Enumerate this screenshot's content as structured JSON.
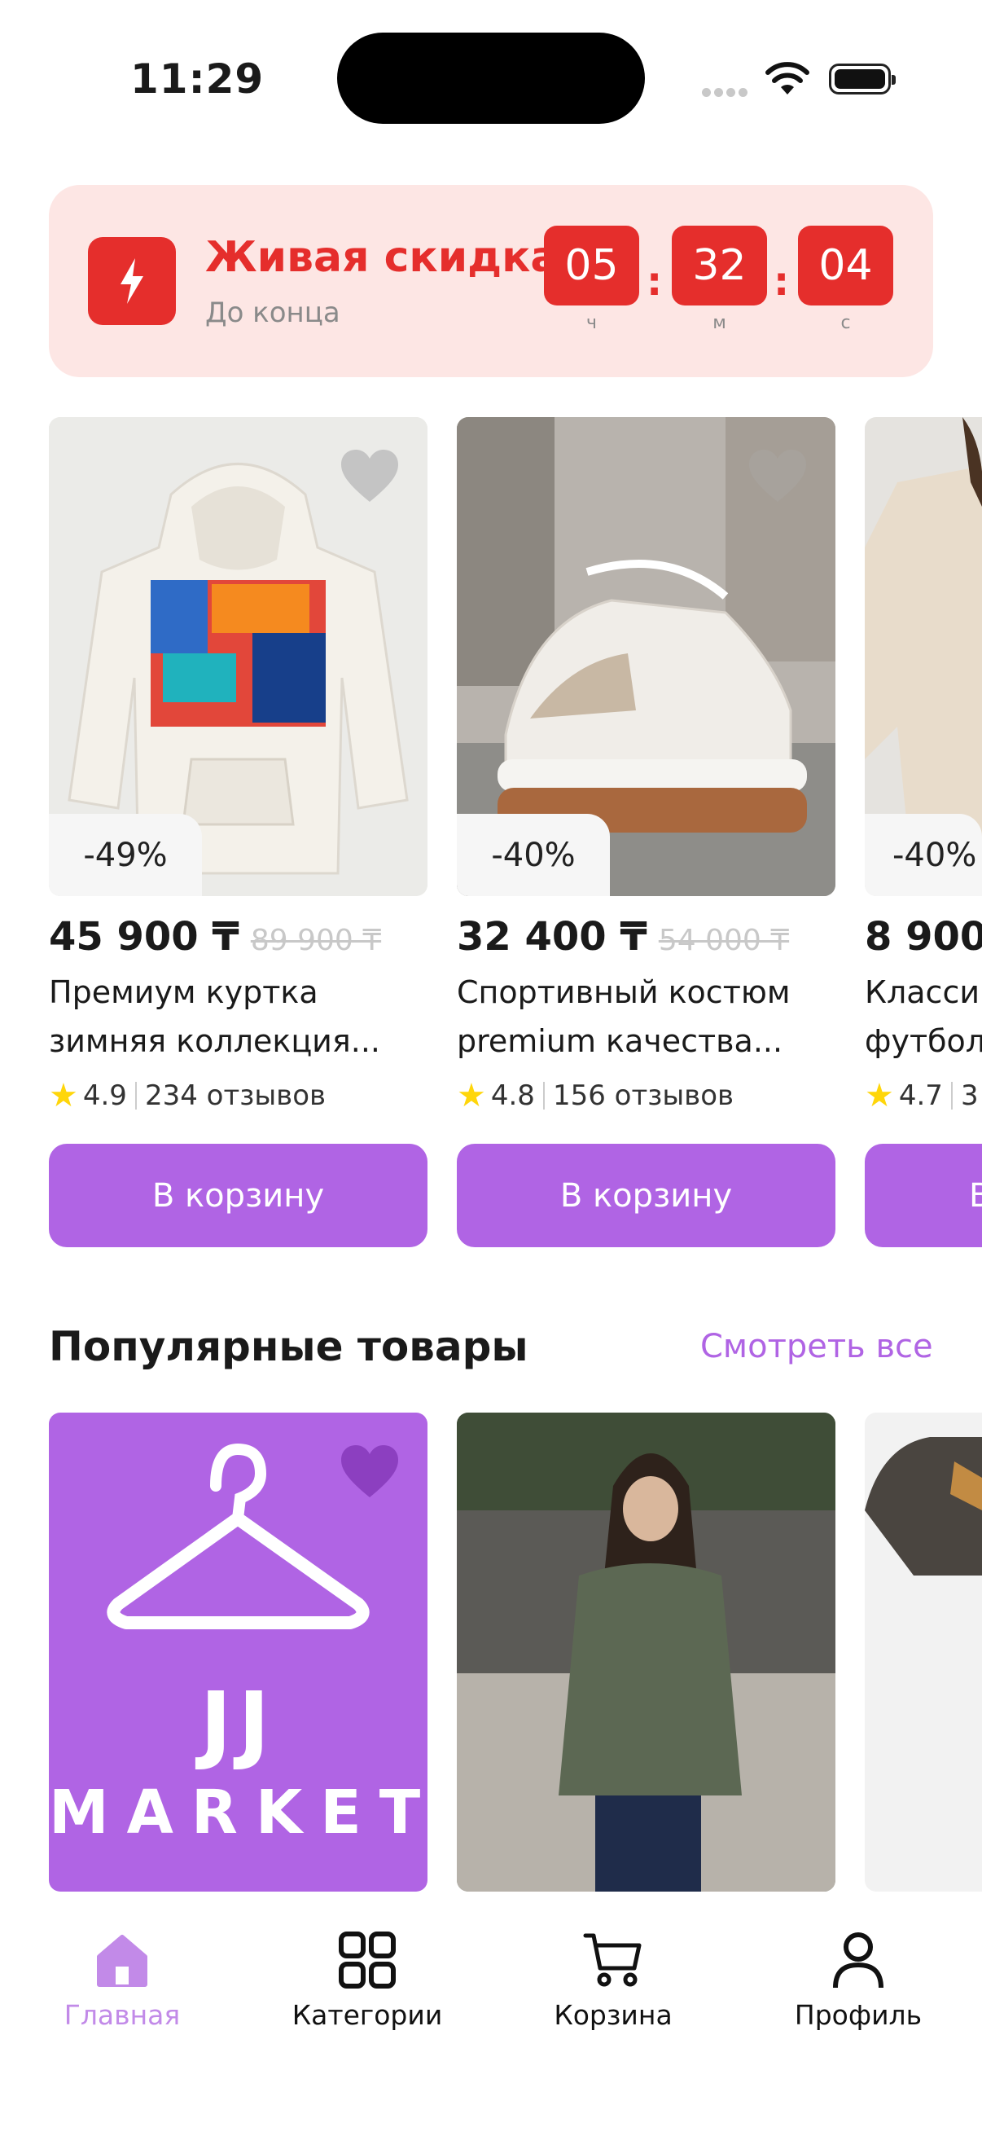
{
  "status_bar": {
    "time": "11:29"
  },
  "banner": {
    "title": "Живая скидка",
    "subtitle": "До конца",
    "timer": [
      {
        "value": "05",
        "unit": "ч"
      },
      {
        "value": "32",
        "unit": "м"
      },
      {
        "value": "04",
        "unit": "с"
      }
    ],
    "separator": ":"
  },
  "deals": [
    {
      "discount": "-49%",
      "price": "45 900 ₸",
      "old_price": "89 900 ₸",
      "name_line1": "Премиум куртка",
      "name_line2": "зимняя коллекция...",
      "rating": "4.9",
      "reviews": "234 отзывов",
      "button": "В корзину"
    },
    {
      "discount": "-40%",
      "price": "32 400 ₸",
      "old_price": "54 000 ₸",
      "name_line1": "Спортивный костюм",
      "name_line2": "premium качества...",
      "rating": "4.8",
      "reviews": "156 отзывов",
      "button": "В корзину"
    },
    {
      "discount": "-40%",
      "price": "8 900",
      "old_price": "",
      "name_line1": "Класси",
      "name_line2": "футбол",
      "rating": "4.7",
      "reviews": "3",
      "button": "В"
    }
  ],
  "popular": {
    "title": "Популярные товары",
    "see_all": "Смотреть все",
    "logo_line1": "JJ",
    "logo_line2": "MARKET"
  },
  "tabbar": [
    {
      "label": "Главная",
      "icon": "home-icon",
      "active": true
    },
    {
      "label": "Категории",
      "icon": "grid-icon",
      "active": false
    },
    {
      "label": "Корзина",
      "icon": "cart-icon",
      "active": false
    },
    {
      "label": "Профиль",
      "icon": "profile-icon",
      "active": false
    }
  ],
  "colors": {
    "accent": "#b064e4",
    "sale_red": "#e52e2c",
    "banner_bg": "#fde6e4",
    "star": "#ffd60a"
  }
}
